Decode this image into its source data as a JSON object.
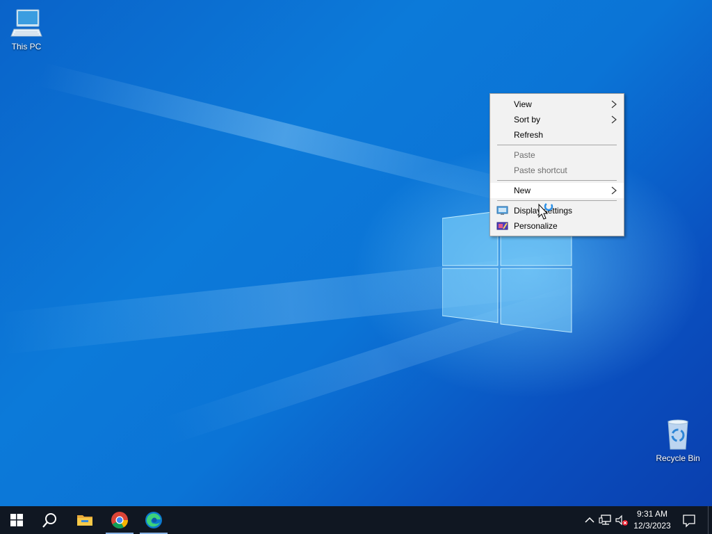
{
  "desktop": {
    "icons": [
      {
        "label": "This PC"
      },
      {
        "label": "Recycle Bin"
      }
    ]
  },
  "context_menu": {
    "view": "View",
    "sort_by": "Sort by",
    "refresh": "Refresh",
    "paste": "Paste",
    "paste_shortcut": "Paste shortcut",
    "new": "New",
    "display_settings": "Display settings",
    "personalize": "Personalize"
  },
  "taskbar": {
    "clock": {
      "time": "9:31 AM",
      "date": "12/3/2023"
    },
    "pinned": [
      "Start",
      "Search",
      "File Explorer",
      "Google Chrome",
      "Microsoft Edge"
    ],
    "tray_icons": [
      "chevron-up-icon",
      "network-icon",
      "volume-muted-icon",
      "notification-icon"
    ]
  },
  "colors": {
    "taskbar": "#101722",
    "menu_bg": "#f2f2f2",
    "menu_hover": "#ffffff",
    "accent": "#0078d7"
  }
}
